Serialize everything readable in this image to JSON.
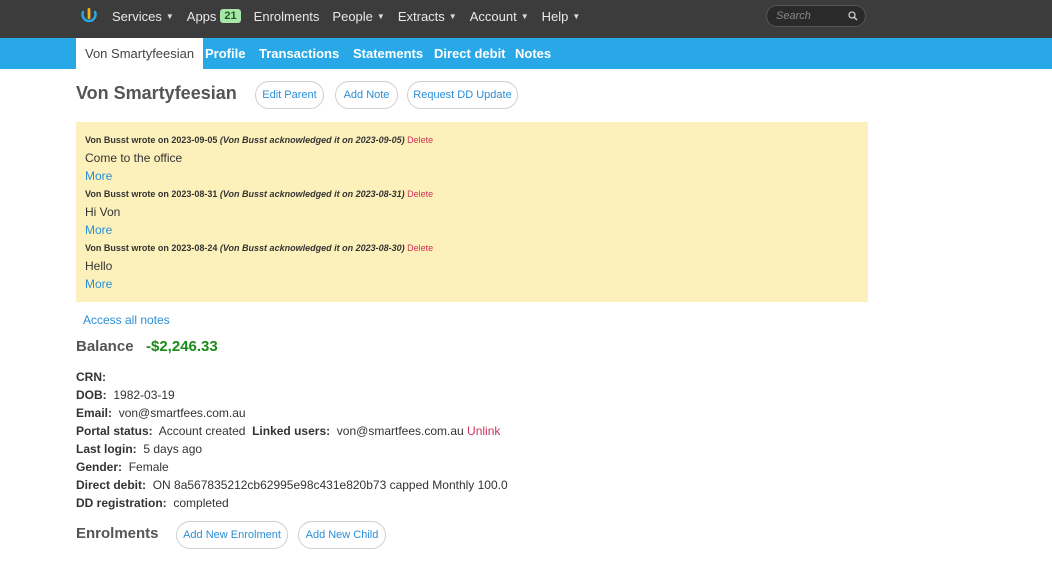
{
  "topbar": {
    "nav": [
      {
        "label": "Services",
        "has_caret": true
      },
      {
        "label": "Apps",
        "badge": "21"
      },
      {
        "label": "Enrolments"
      },
      {
        "label": "People",
        "has_caret": true
      },
      {
        "label": "Extracts",
        "has_caret": true
      },
      {
        "label": "Account",
        "has_caret": true
      },
      {
        "label": "Help",
        "has_caret": true
      }
    ],
    "search_placeholder": "Search"
  },
  "subnav": {
    "tabs": [
      "Von Smartyfeesian",
      "Profile",
      "Transactions",
      "Statements",
      "Direct debit",
      "Notes"
    ]
  },
  "header": {
    "title": "Von Smartyfeesian",
    "edit_parent": "Edit Parent",
    "add_note": "Add Note",
    "request_dd": "Request DD Update"
  },
  "notes": [
    {
      "by": "Von Busst wrote on 2023-09-05",
      "ack": "(Von Busst acknowledged it on 2023-09-05)",
      "delete": "Delete",
      "body": "Come to the office",
      "more": "More"
    },
    {
      "by": "Von Busst wrote on 2023-08-31",
      "ack": "(Von Busst acknowledged it on 2023-08-31)",
      "delete": "Delete",
      "body": "Hi Von",
      "more": "More"
    },
    {
      "by": "Von Busst wrote on 2023-08-24",
      "ack": "(Von Busst acknowledged it on 2023-08-30)",
      "delete": "Delete",
      "body": "Hello",
      "more": "More"
    }
  ],
  "access_all_notes": "Access all notes",
  "balance": {
    "label": "Balance",
    "value": "-$2,246.33"
  },
  "details": {
    "crn_label": "CRN:",
    "dob_label": "DOB:",
    "dob_value": "1982-03-19",
    "email_label": "Email:",
    "email_value": "von@smartfees.com.au",
    "portal_label": "Portal status:",
    "portal_value": "Account created",
    "linked_label": "Linked users:",
    "linked_value": "von@smartfees.com.au",
    "unlink": "Unlink",
    "login_label": "Last login:",
    "login_value": "5 days  ago",
    "gender_label": "Gender:",
    "gender_value": "Female",
    "dd_label": "Direct debit:",
    "dd_value": "ON 8a567835212cb62995e98c431e820b73 capped Monthly 100.0",
    "ddreg_label": "DD registration:",
    "ddreg_value": "completed"
  },
  "enrolments": {
    "title": "Enrolments",
    "add_enrolment": "Add New Enrolment",
    "add_child": "Add New Child"
  },
  "colors": {
    "topbar": "#3c3c3c",
    "subnav": "#29a8e7",
    "notes_bg": "#fdf1bb",
    "link": "#2b8fd6",
    "delete": "#d0305a",
    "balance": "#1a8a1a"
  }
}
